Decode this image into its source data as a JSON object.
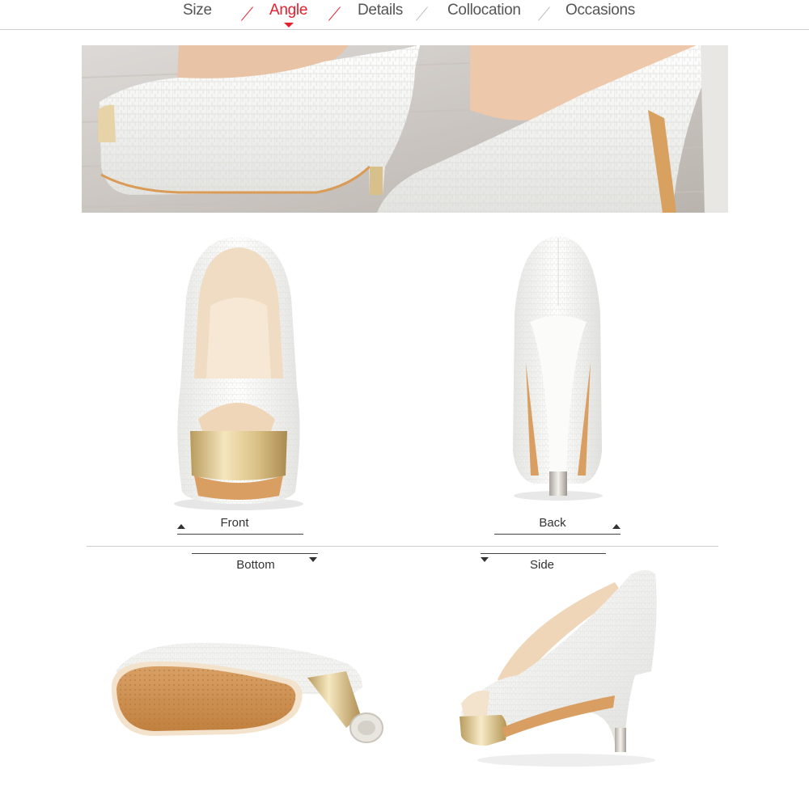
{
  "nav": {
    "tabs": [
      {
        "label": "Size",
        "active": false
      },
      {
        "label": "Angle",
        "active": true
      },
      {
        "label": "Details",
        "active": false
      },
      {
        "label": "Collocation",
        "active": false
      },
      {
        "label": "Occasions",
        "active": false
      }
    ],
    "active_color": "#e5202e"
  },
  "views": {
    "front": {
      "label": "Front"
    },
    "back": {
      "label": "Back"
    },
    "bottom": {
      "label": "Bottom"
    },
    "side": {
      "label": "Side"
    }
  },
  "colors": {
    "shoe": "#f4f4f2",
    "lining": "#efd9bf",
    "sole": "#c98a4a",
    "gold": "#d8c08a"
  }
}
